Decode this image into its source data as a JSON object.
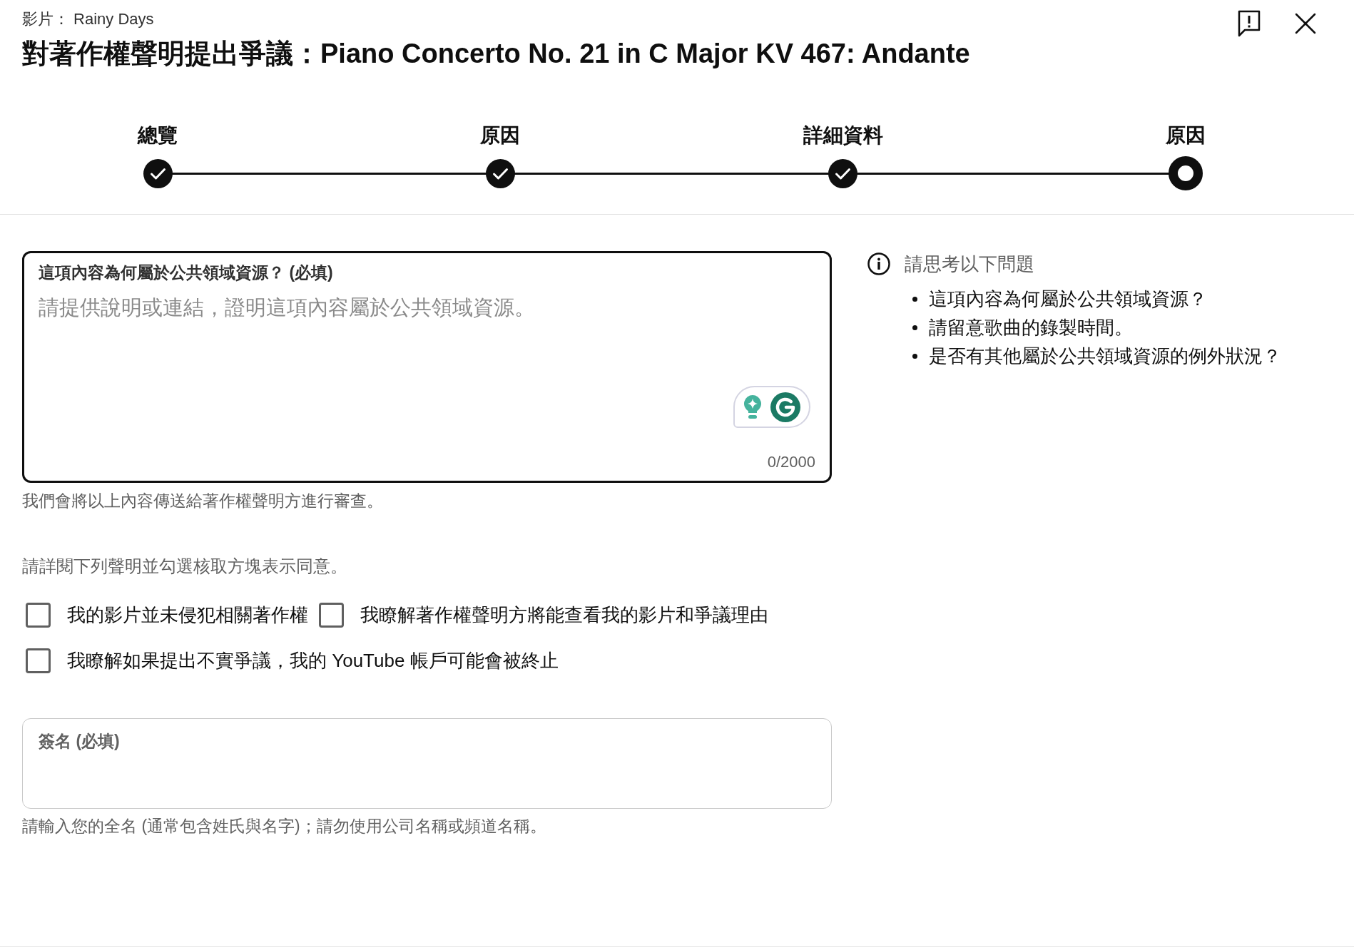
{
  "header": {
    "context": "影片： Rainy Days",
    "title": "對著作權聲明提出爭議：Piano Concerto No. 21 in C Major KV 467: Andante"
  },
  "steps": [
    {
      "label": "總覽",
      "completed": true,
      "selected": false
    },
    {
      "label": "原因",
      "completed": true,
      "selected": false
    },
    {
      "label": "詳細資料",
      "completed": true,
      "selected": false
    },
    {
      "label": "原因",
      "completed": false,
      "selected": true
    }
  ],
  "reason_field": {
    "label": "這項內容為何屬於公共領域資源？ (必填)",
    "placeholder": "請提供說明或連結，證明這項內容屬於公共領域資源。",
    "counter": "0/2000",
    "focused": true
  },
  "tips": {
    "heading": "請思考以下問題",
    "items": [
      "這項內容為何屬於公共領域資源？",
      "請留意歌曲的錄製時間。",
      "是否有其他屬於公共領域資源的例外狀況？"
    ]
  },
  "reason_note": "我們會將以上內容傳送給著作權聲明方進行審查。",
  "agreement": {
    "instruction": "請詳閱下列聲明並勾選核取方塊表示同意。",
    "checkboxes": [
      {
        "label": "我的影片並未侵犯相關著作權",
        "checked": false
      },
      {
        "label": "我瞭解著作權聲明方將能查看我的影片和爭議理由",
        "checked": false
      },
      {
        "label": "我瞭解如果提出不實爭議，我的 YouTube 帳戶可能會被終止",
        "checked": false
      }
    ]
  },
  "signature_field": {
    "label": "簽名 (必填)",
    "focused": false
  },
  "signature_note": "請輸入您的全名 (通常包含姓氏與名字)；請勿使用公司名稱或頻道名稱。"
}
